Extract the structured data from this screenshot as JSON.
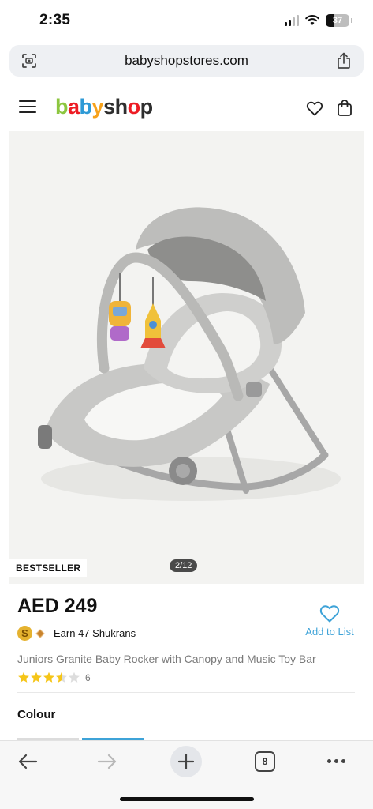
{
  "status_bar": {
    "time": "2:35",
    "battery_level": "37",
    "icons": [
      "signal-icon",
      "wifi-icon",
      "battery-icon"
    ]
  },
  "browser": {
    "url": "babyshopstores.com",
    "left_icon": "page-settings-icon",
    "right_icon": "share-icon",
    "toolbar": {
      "back_icon": "back-arrow-icon",
      "forward_icon": "forward-arrow-icon",
      "new_tab_icon": "plus-icon",
      "tab_count": "8",
      "more_icon": "more-dots-icon"
    }
  },
  "header": {
    "logo_letters": [
      "b",
      "a",
      "b",
      "y",
      "s",
      "h",
      "o",
      "p"
    ],
    "logo_colors": [
      "#8cc63f",
      "#ed1c24",
      "#2e9ad6",
      "#f7a21b",
      "#2e2e2e",
      "#2e2e2e",
      "#ed1c24",
      "#2e2e2e"
    ],
    "menu_icon": "hamburger-menu-icon",
    "wishlist_icon": "heart-icon",
    "cart_icon": "shopping-bag-icon"
  },
  "gallery": {
    "badge": "BESTSELLER",
    "counter": "2/12",
    "image_subject": "grey baby rocker with canopy and hanging toy bar"
  },
  "product": {
    "price": "AED 249",
    "shukrans_text": "Earn 47 Shukrans",
    "coin_letter": "S",
    "add_to_list_label": "Add to List",
    "add_to_list_icon": "heart-outline-icon",
    "name": "Juniors Granite Baby Rocker with Canopy and Music Toy Bar",
    "rating": 3.5,
    "rating_max": 5,
    "review_count": "6",
    "colour_label": "Colour"
  },
  "colors": {
    "accent": "#3ea3d8",
    "star": "#f5c518",
    "star_empty": "#dddddd"
  }
}
